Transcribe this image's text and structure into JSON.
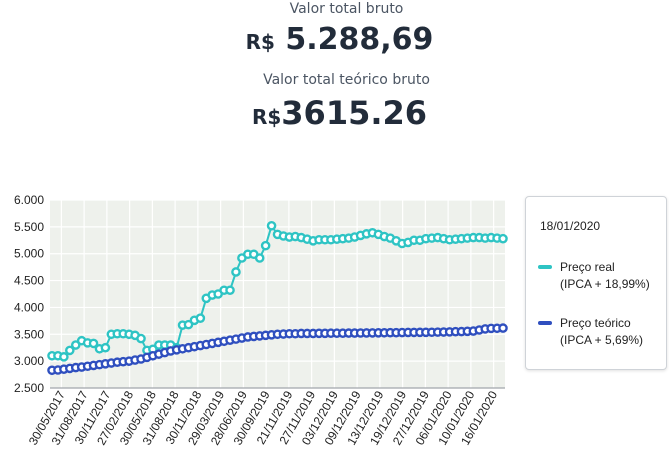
{
  "summary": {
    "gross_label": "Valor total bruto",
    "gross_currency": "R$",
    "gross_value": "5.288,69",
    "theoretical_label": "Valor total teórico bruto",
    "theoretical_currency": "R$",
    "theoretical_value": "3615.26"
  },
  "legend": {
    "date": "18/01/2020",
    "items": [
      {
        "name": "Preço real",
        "detail": "(IPCA + 18,99%)",
        "color": "#2ec4c4"
      },
      {
        "name": "Preço teórico",
        "detail": "(IPCA + 5,69%)",
        "color": "#2f4fbf"
      }
    ]
  },
  "chart_data": {
    "type": "line",
    "ylim": [
      2500,
      6000
    ],
    "y_ticks": [
      "2.500",
      "3.000",
      "3.500",
      "4.000",
      "4.500",
      "5.000",
      "5.500",
      "6.000"
    ],
    "x_tick_labels": [
      "30/05/2017",
      "31/08/2017",
      "30/11/2017",
      "27/02/2018",
      "30/05/2018",
      "31/08/2018",
      "30/11/2018",
      "29/03/2019",
      "28/06/2019",
      "30/09/2019",
      "21/11/2019",
      "27/11/2019",
      "03/12/2019",
      "09/12/2019",
      "13/12/2019",
      "19/12/2019",
      "27/12/2019",
      "06/01/2020",
      "10/01/2020",
      "16/01/2020"
    ],
    "grid": true,
    "series": [
      {
        "name": "Preço real",
        "color": "#2ec4c4",
        "values": [
          3100,
          3100,
          3080,
          3200,
          3300,
          3380,
          3340,
          3330,
          3230,
          3250,
          3500,
          3510,
          3510,
          3500,
          3480,
          3420,
          3200,
          3220,
          3300,
          3300,
          3300,
          3250,
          3670,
          3680,
          3760,
          3800,
          4170,
          4230,
          4250,
          4320,
          4320,
          4660,
          4920,
          4990,
          4990,
          4920,
          5150,
          5520,
          5360,
          5330,
          5310,
          5320,
          5300,
          5270,
          5240,
          5260,
          5260,
          5260,
          5270,
          5280,
          5290,
          5310,
          5340,
          5370,
          5390,
          5360,
          5320,
          5290,
          5240,
          5190,
          5210,
          5250,
          5250,
          5280,
          5290,
          5300,
          5280,
          5260,
          5270,
          5280,
          5290,
          5300,
          5300,
          5290,
          5300,
          5290,
          5280
        ]
      },
      {
        "name": "Preço teórico",
        "color": "#2f4fbf",
        "values": [
          2830,
          2835,
          2850,
          2865,
          2880,
          2890,
          2905,
          2920,
          2935,
          2950,
          2965,
          2980,
          2990,
          3000,
          3020,
          3040,
          3070,
          3100,
          3130,
          3160,
          3190,
          3210,
          3230,
          3250,
          3270,
          3290,
          3310,
          3330,
          3350,
          3370,
          3390,
          3410,
          3430,
          3450,
          3460,
          3470,
          3480,
          3490,
          3500,
          3505,
          3510,
          3510,
          3515,
          3515,
          3515,
          3518,
          3518,
          3520,
          3520,
          3520,
          3522,
          3523,
          3524,
          3525,
          3526,
          3527,
          3528,
          3530,
          3530,
          3532,
          3534,
          3535,
          3536,
          3537,
          3538,
          3540,
          3542,
          3545,
          3548,
          3550,
          3555,
          3560,
          3580,
          3600,
          3610,
          3612,
          3615
        ]
      }
    ]
  }
}
